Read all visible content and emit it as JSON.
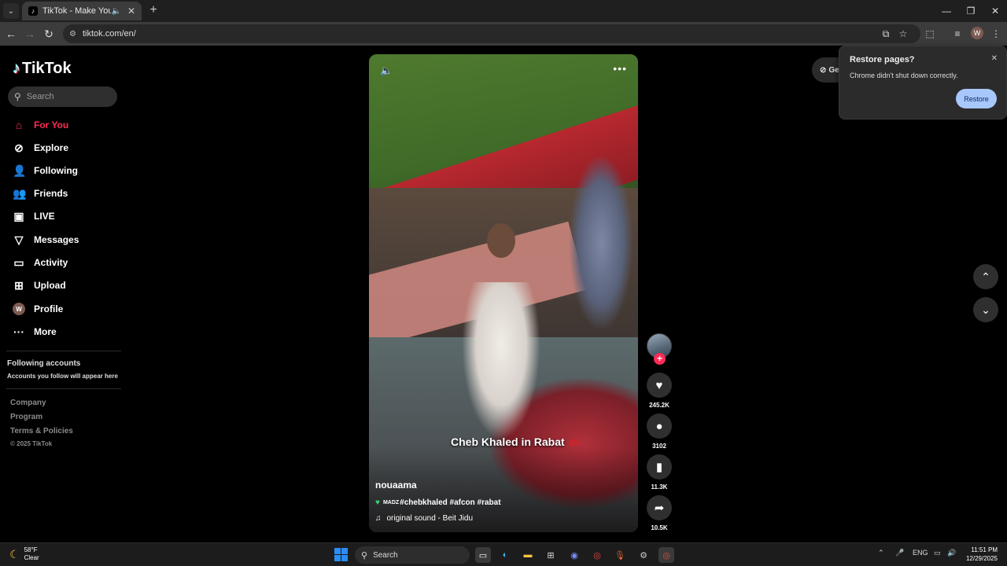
{
  "browser": {
    "tab_title": "TikTok - Make Your Day",
    "url": "tiktok.com/en/",
    "profile_initial": "W"
  },
  "sidebar": {
    "logo": "TikTok",
    "search_placeholder": "Search",
    "nav": [
      {
        "label": "For You",
        "icon": "home-icon",
        "active": true
      },
      {
        "label": "Explore",
        "icon": "compass-icon"
      },
      {
        "label": "Following",
        "icon": "user-follow-icon"
      },
      {
        "label": "Friends",
        "icon": "friends-icon"
      },
      {
        "label": "LIVE",
        "icon": "live-icon"
      },
      {
        "label": "Messages",
        "icon": "send-icon"
      },
      {
        "label": "Activity",
        "icon": "inbox-icon"
      },
      {
        "label": "Upload",
        "icon": "upload-icon"
      },
      {
        "label": "Profile",
        "icon": "avatar"
      },
      {
        "label": "More",
        "icon": "more-icon"
      }
    ],
    "profile_initial": "W",
    "following_title": "Following accounts",
    "following_subtitle": "Accounts you follow will appear here",
    "footer": [
      "Company",
      "Program",
      "Terms & Policies"
    ],
    "copyright": "© 2025 TikTok"
  },
  "video": {
    "overlay_caption": "Cheb Khaled in Rabat",
    "author": "nouaama",
    "description_prefix": "MADZ",
    "description_tags": "#chebkhaled #afcon #rabat",
    "sound": "original sound - Beit Jidu"
  },
  "actions": {
    "likes": "245.2K",
    "comments": "3102",
    "saves": "11.3K",
    "shares": "10.5K"
  },
  "get_app_label": "Get",
  "restore_popup": {
    "title": "Restore pages?",
    "body": "Chrome didn't shut down correctly.",
    "button": "Restore"
  },
  "taskbar": {
    "temperature": "58°F",
    "condition": "Clear",
    "search_label": "Search",
    "language": "ENG",
    "time": "11:51 PM",
    "date": "12/29/2025"
  },
  "colors": {
    "accent": "#fe2c55",
    "background": "#000000",
    "restore_button": "#a8c7fa"
  }
}
